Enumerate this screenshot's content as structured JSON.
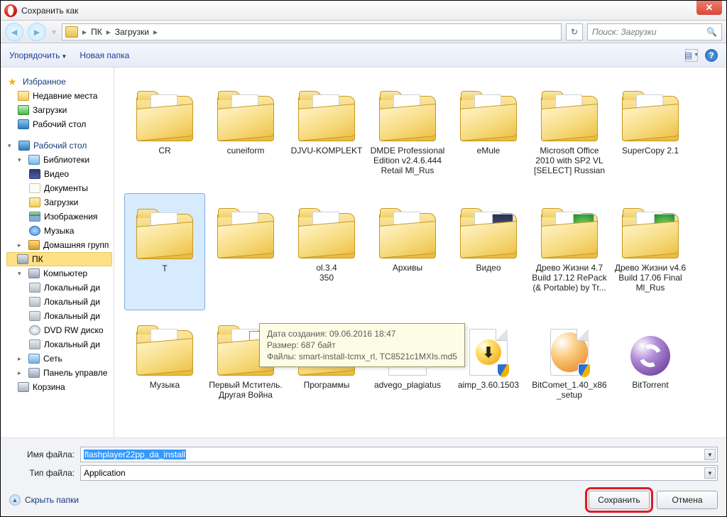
{
  "window": {
    "title": "Сохранить как"
  },
  "breadcrumb": {
    "part1": "ПК",
    "part2": "Загрузки",
    "search_placeholder": "Поиск: Загрузки"
  },
  "toolbar": {
    "organize": "Упорядочить",
    "newfolder": "Новая папка"
  },
  "tree": {
    "favorites": "Избранное",
    "recent": "Недавние места",
    "downloads": "Загрузки",
    "desktop_fav": "Рабочий стол",
    "desktop": "Рабочий стол",
    "libraries": "Библиотеки",
    "video": "Видео",
    "documents": "Документы",
    "downloads2": "Загрузки",
    "images": "Изображения",
    "music": "Музыка",
    "homegroup": "Домашняя групп",
    "pc": "ПК",
    "computer": "Компьютер",
    "disk1": "Локальный ди",
    "disk2": "Локальный ди",
    "disk3": "Локальный ди",
    "dvd": "DVD RW диско",
    "disk4": "Локальный ди",
    "network": "Сеть",
    "cpanel": "Панель управле",
    "bin": "Корзина"
  },
  "items": {
    "r1": [
      "CR",
      "cuneiform",
      "DJVU-KOMPLEKT",
      "DMDE Professional Edition v2.4.6.444 Retail Ml_Rus",
      "eMule",
      "Microsoft Office 2010 with SP2 VL [SELECT] Russian",
      "SuperCopy 2.1"
    ],
    "r2_first": "T",
    "r2_mid_suffix": "ol.3.4",
    "r2_mid_suffix2": "350",
    "r2_rest": [
      "Архивы",
      "Видео",
      "Древо Жизни 4.7 Build 17.12 RePack (& Portable) by Tr...",
      "Древо Жизни v4.6 Build 17.06 Final Ml_Rus"
    ],
    "r3_folders": [
      "Музыка",
      "Первый Мститель. Другая Война",
      "Программы"
    ],
    "r3_files": [
      "advego_plagiatus",
      "aimp_3.60.1503",
      "BitComet_1.40_x86_setup",
      "BitTorrent"
    ]
  },
  "tooltip": {
    "l1": "Дата создания: 09.06.2016 18:47",
    "l2": "Размер: 687 байт",
    "l3": "Файлы: smart-install-tcmx_rl, TC8521c1MXIs.md5"
  },
  "bottom": {
    "name_label": "Имя файла:",
    "name_value": "flashplayer22pp_da_install",
    "type_label": "Тип файла:",
    "type_value": "Application",
    "hide": "Скрыть папки",
    "save": "Сохранить",
    "cancel": "Отмена"
  }
}
